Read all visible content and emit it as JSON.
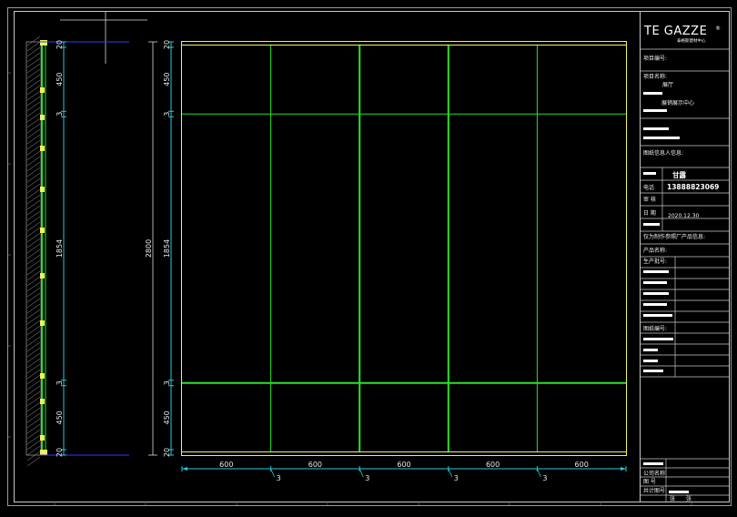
{
  "colors": {
    "background": "#000000",
    "frame": "#c8c8c8",
    "panel_grid": "#27e327",
    "panel_outline": "#f2f25a",
    "dimension": "#29c7e0",
    "dimension_blue": "#2f3cff",
    "text": "#ffffff"
  },
  "vertical_dims": {
    "side": [
      "20",
      "450",
      "3",
      "1854",
      "3",
      "450",
      "20"
    ],
    "main": [
      "20",
      "450",
      "3",
      "1854",
      "3",
      "450",
      "20"
    ],
    "total": "2800"
  },
  "horizontal_dims": {
    "widths": [
      "600",
      "600",
      "600",
      "600",
      "600"
    ],
    "gaps": [
      "3",
      "3",
      "3",
      "3"
    ]
  },
  "title_block": {
    "logo": "TE GAZZE",
    "logo_registered": "®",
    "logo_sub": "泰格斯建材中心",
    "project_no_label": "项目编号:",
    "project_name_label": "项目名称:",
    "project_name": "展厅",
    "client": "展销展示中心",
    "drawing_info_label": "图纸信息人信息:",
    "name_value": "甘露",
    "phone_label": "电话",
    "phone": "13888823069",
    "review_label": "审 核",
    "date_label": "日 期",
    "date": "2020.12.30",
    "product_info_label": "仅为制作参照厂产品信息:",
    "product_name_label": "产品名称:",
    "product_code_label": "生产批号:",
    "drawing_no_label": "图纸编号:",
    "bottom_label_1": "公司名称",
    "bottom_label_2": "图 号",
    "bottom_label_3": "共计图号",
    "sheet_label": "张",
    "sheet_value": "张"
  }
}
